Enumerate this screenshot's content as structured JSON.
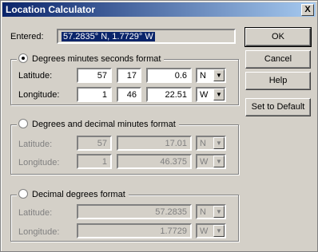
{
  "window": {
    "title": "Location Calculator",
    "close_label": "X"
  },
  "entered": {
    "label": "Entered:",
    "value": "57.2835° N, 1.7729° W"
  },
  "dms": {
    "option_label": "Degrees minutes seconds format",
    "selected": true,
    "latitude": {
      "label": "Latitude:",
      "deg": "57",
      "min": "17",
      "sec": "0.6",
      "dir": "N"
    },
    "longitude": {
      "label": "Longitude:",
      "deg": "1",
      "min": "46",
      "sec": "22.51",
      "dir": "W"
    }
  },
  "ddm": {
    "option_label": "Degrees and decimal minutes format",
    "selected": false,
    "latitude": {
      "label": "Latitude:",
      "deg": "57",
      "min": "17.01",
      "dir": "N"
    },
    "longitude": {
      "label": "Longitude:",
      "deg": "1",
      "min": "46.375",
      "dir": "W"
    }
  },
  "dd": {
    "option_label": "Decimal degrees format",
    "selected": false,
    "latitude": {
      "label": "Latitude:",
      "value": "57.2835",
      "dir": "N"
    },
    "longitude": {
      "label": "Longitude:",
      "value": "1.7729",
      "dir": "W"
    }
  },
  "buttons": {
    "ok": "OK",
    "cancel": "Cancel",
    "help": "Help",
    "set_default": "Set to Default"
  }
}
